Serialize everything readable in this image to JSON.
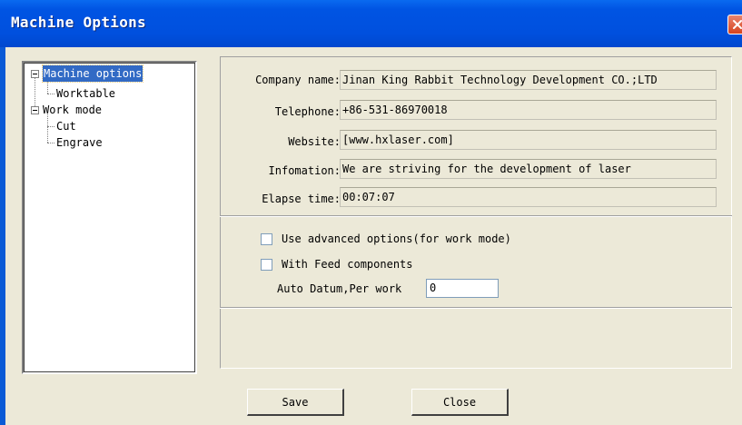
{
  "window": {
    "title": "Machine Options"
  },
  "tree": {
    "items": [
      {
        "label": "Machine options",
        "selected": true
      },
      {
        "label": "Worktable"
      },
      {
        "label": "Work mode"
      },
      {
        "label": "Cut"
      },
      {
        "label": "Engrave"
      }
    ]
  },
  "info": {
    "company_label": "Company name:",
    "company_value": "Jinan King Rabbit Technology Development CO.;LTD",
    "telephone_label": "Telephone:",
    "telephone_value": "+86-531-86970018",
    "website_label": "Website:",
    "website_value": "[www.hxlaser.com]",
    "information_label": "Infomation:",
    "information_value": "We are striving for the development of laser",
    "elapse_label": "Elapse time:",
    "elapse_value": "00:07:07"
  },
  "options": {
    "advanced_label": "Use advanced options(for work mode)",
    "advanced_checked": false,
    "feed_label": "With Feed components",
    "feed_checked": false,
    "auto_datum_label": "Auto Datum,Per work",
    "auto_datum_value": "0"
  },
  "buttons": {
    "save": "Save",
    "close": "Close"
  }
}
